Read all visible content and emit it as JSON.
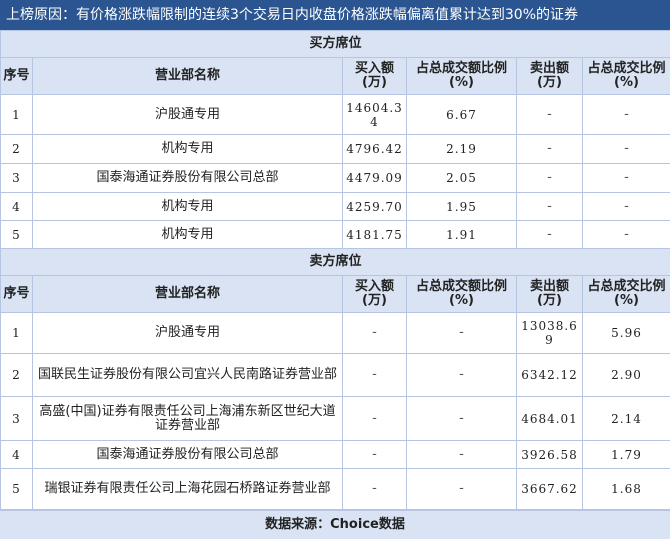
{
  "title": "上榜原因：有价格涨跌幅限制的连续3个交易日内收盘价格涨跌幅偏离值累计达到30%的证券",
  "columns": {
    "seq": "序号",
    "name": "营业部名称",
    "buy": "买入额(万)",
    "buy_pct": "占总成交额比例(%)",
    "sell": "卖出额(万)",
    "sell_pct": "占总成交比例(%)"
  },
  "buy_section": {
    "label": "买方席位",
    "rows": [
      {
        "seq": "1",
        "name": "沪股通专用",
        "buy": "14604.34",
        "buy_pct": "6.67",
        "sell": "-",
        "sell_pct": "-"
      },
      {
        "seq": "2",
        "name": "机构专用",
        "buy": "4796.42",
        "buy_pct": "2.19",
        "sell": "-",
        "sell_pct": "-"
      },
      {
        "seq": "3",
        "name": "国泰海通证券股份有限公司总部",
        "buy": "4479.09",
        "buy_pct": "2.05",
        "sell": "-",
        "sell_pct": "-"
      },
      {
        "seq": "4",
        "name": "机构专用",
        "buy": "4259.70",
        "buy_pct": "1.95",
        "sell": "-",
        "sell_pct": "-"
      },
      {
        "seq": "5",
        "name": "机构专用",
        "buy": "4181.75",
        "buy_pct": "1.91",
        "sell": "-",
        "sell_pct": "-"
      }
    ]
  },
  "sell_section": {
    "label": "卖方席位",
    "rows": [
      {
        "seq": "1",
        "name": "沪股通专用",
        "buy": "-",
        "buy_pct": "-",
        "sell": "13038.69",
        "sell_pct": "5.96"
      },
      {
        "seq": "2",
        "name": "国联民生证券股份有限公司宜兴人民南路证券营业部",
        "buy": "-",
        "buy_pct": "-",
        "sell": "6342.12",
        "sell_pct": "2.90"
      },
      {
        "seq": "3",
        "name": "高盛(中国)证券有限责任公司上海浦东新区世纪大道证券营业部",
        "buy": "-",
        "buy_pct": "-",
        "sell": "4684.01",
        "sell_pct": "2.14"
      },
      {
        "seq": "4",
        "name": "国泰海通证券股份有限公司总部",
        "buy": "-",
        "buy_pct": "-",
        "sell": "3926.58",
        "sell_pct": "1.79"
      },
      {
        "seq": "5",
        "name": "瑞银证券有限责任公司上海花园石桥路证券营业部",
        "buy": "-",
        "buy_pct": "-",
        "sell": "3667.62",
        "sell_pct": "1.68"
      }
    ]
  },
  "footer": "数据来源：Choice数据"
}
